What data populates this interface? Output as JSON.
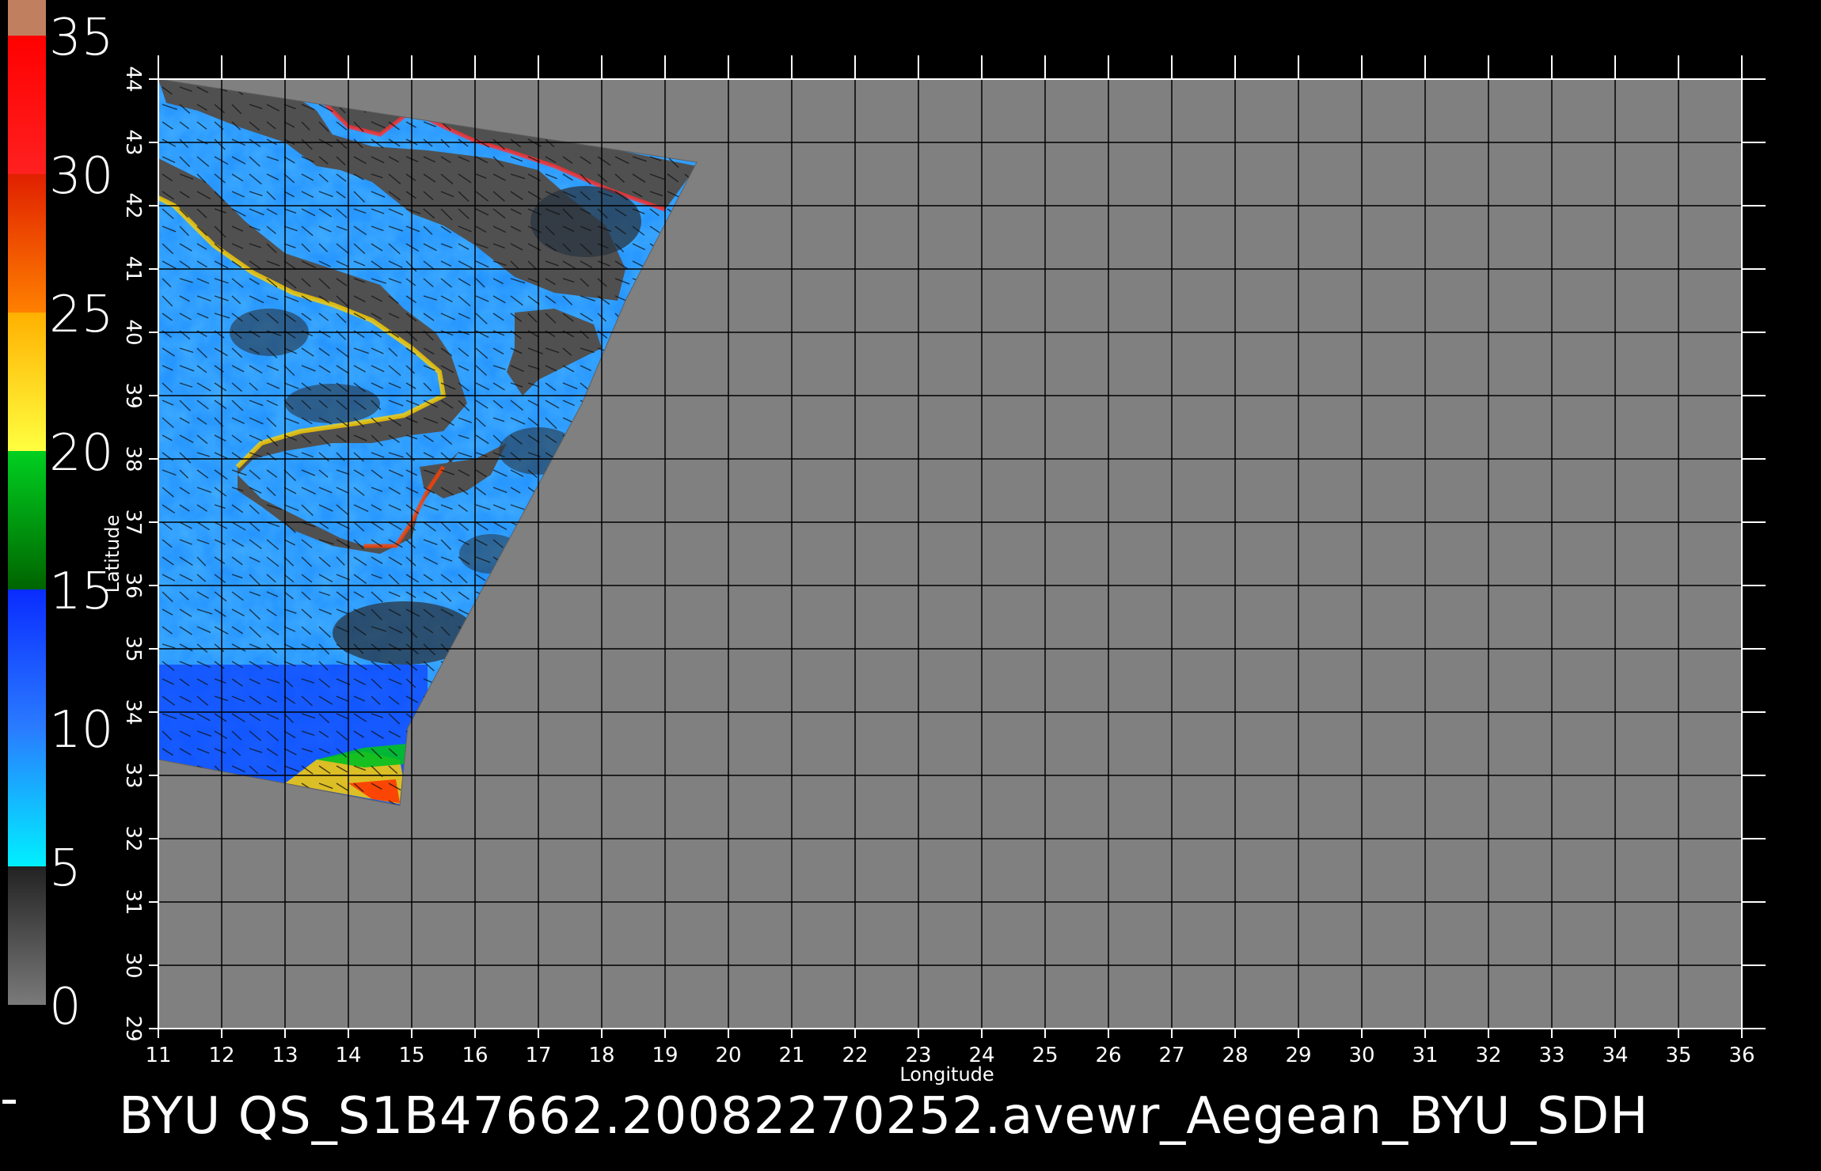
{
  "chart_data": {
    "type": "heatmap",
    "title": "BYU  QS_S1B47662.20082270252.avewr_Aegean_BYU_SDH",
    "xlabel": "Longitude",
    "ylabel": "Latitude",
    "xlim": [
      11,
      36
    ],
    "ylim": [
      29,
      44
    ],
    "x_ticks": [
      "11",
      "12",
      "13",
      "14",
      "15",
      "16",
      "17",
      "18",
      "19",
      "20",
      "21",
      "22",
      "23",
      "24",
      "25",
      "26",
      "27",
      "28",
      "29",
      "30",
      "31",
      "32",
      "33",
      "34",
      "35",
      "36"
    ],
    "y_ticks": [
      "29",
      "30",
      "31",
      "32",
      "33",
      "34",
      "35",
      "36",
      "37",
      "38",
      "39",
      "40",
      "41",
      "42",
      "43",
      "44"
    ],
    "grid": true,
    "colorbar": {
      "range": [
        0,
        35
      ],
      "tick_labels": [
        "0",
        "5",
        "10",
        "15",
        "20",
        "25",
        "30",
        "35"
      ],
      "stops": [
        {
          "from": 0,
          "to": 5,
          "colors": [
            "#7a7a7a",
            "#222222"
          ]
        },
        {
          "from": 5,
          "to": 10,
          "colors": [
            "#00f0ff",
            "#2a7bff"
          ]
        },
        {
          "from": 10,
          "to": 15,
          "colors": [
            "#2a7bff",
            "#0a2cff"
          ]
        },
        {
          "from": 15,
          "to": 20,
          "colors": [
            "#006400",
            "#00d020"
          ]
        },
        {
          "from": 20,
          "to": 25,
          "colors": [
            "#ffff40",
            "#ffb000"
          ]
        },
        {
          "from": 25,
          "to": 30,
          "colors": [
            "#ff8000",
            "#e02000"
          ]
        },
        {
          "from": 30,
          "to": 35,
          "colors": [
            "#ff2020",
            "#ff0000"
          ]
        }
      ],
      "top_color": "#c08060"
    },
    "colors": {
      "background": "#000000",
      "no_data": "#808080",
      "land": "#505050",
      "grid": "#000000",
      "axes": "#ffffff"
    }
  }
}
